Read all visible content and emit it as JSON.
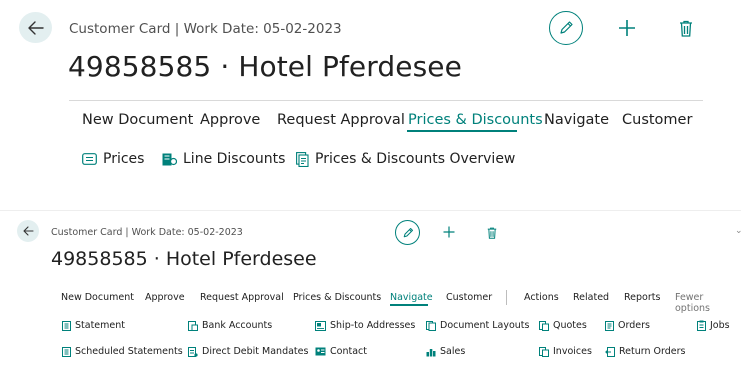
{
  "large": {
    "context": "Customer Card | Work Date: 05-02-2023",
    "title": "49858585 · Hotel Pferdesee",
    "menu": [
      "New Document",
      "Approve",
      "Request Approval",
      "Prices & Discounts",
      "Navigate",
      "Customer"
    ],
    "active_menu": "Prices & Discounts",
    "actions": [
      "Prices",
      "Line Discounts",
      "Prices & Discounts Overview"
    ],
    "icons": {
      "back": "back-arrow-icon",
      "edit": "pencil-icon",
      "new": "plus-icon",
      "delete": "trash-icon"
    }
  },
  "small": {
    "context": "Customer Card | Work Date: 05-02-2023",
    "title": "49858585 · Hotel Pferdesee",
    "menu": [
      "New Document",
      "Approve",
      "Request Approval",
      "Prices & Discounts",
      "Navigate",
      "Customer"
    ],
    "active_menu": "Navigate",
    "secondary_menu": [
      "Actions",
      "Related",
      "Reports",
      "Fewer options"
    ],
    "actions_row1": [
      "Statement",
      "Bank Accounts",
      "Ship-to Addresses",
      "Document Layouts",
      "Quotes",
      "Orders",
      "Jobs"
    ],
    "actions_row2": [
      "Scheduled Statements",
      "Direct Debit Mandates",
      "Contact",
      "Sales",
      "Invoices",
      "Return Orders"
    ]
  },
  "colors": {
    "accent": "#00817b",
    "back_bg": "#e3eff0"
  }
}
